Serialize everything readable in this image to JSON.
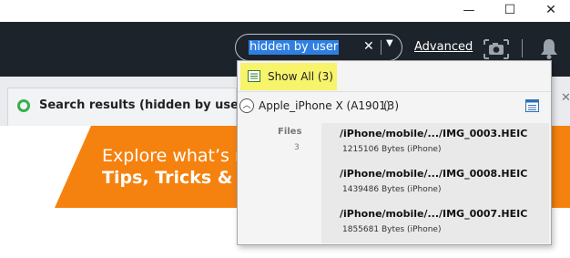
{
  "window": {
    "minimize": "—",
    "maximize": "☐",
    "close": "✕"
  },
  "search": {
    "value": "hidden by user",
    "clear": "✕",
    "dropdown": "▼"
  },
  "toolbar": {
    "advanced": "Advanced",
    "camera_icon": "camera-icon",
    "bell_icon": "bell-icon"
  },
  "tab": {
    "label": "Search results (hidden by use...",
    "close": "✕"
  },
  "banner": {
    "line1": "Explore what’s n",
    "line2": "Tips, Tricks & Tu"
  },
  "dropdown": {
    "show_all": "Show All (3)",
    "device": {
      "name": "Apple_iPhone X (A1901)",
      "count": "(3)"
    },
    "files_header": "Files",
    "files_count": "3",
    "results": [
      {
        "path": "/iPhone/mobile/.../IMG_0003.HEIC",
        "meta": "1215106 Bytes (iPhone)"
      },
      {
        "path": "/iPhone/mobile/.../IMG_0008.HEIC",
        "meta": "1439486 Bytes (iPhone)"
      },
      {
        "path": "/iPhone/mobile/.../IMG_0007.HEIC",
        "meta": "1855681 Bytes (iPhone)"
      }
    ]
  },
  "colors": {
    "toolbar": "#1d232b",
    "highlight": "#f7f36a",
    "banner": "#f5820f",
    "selection": "#2f7fe2"
  }
}
